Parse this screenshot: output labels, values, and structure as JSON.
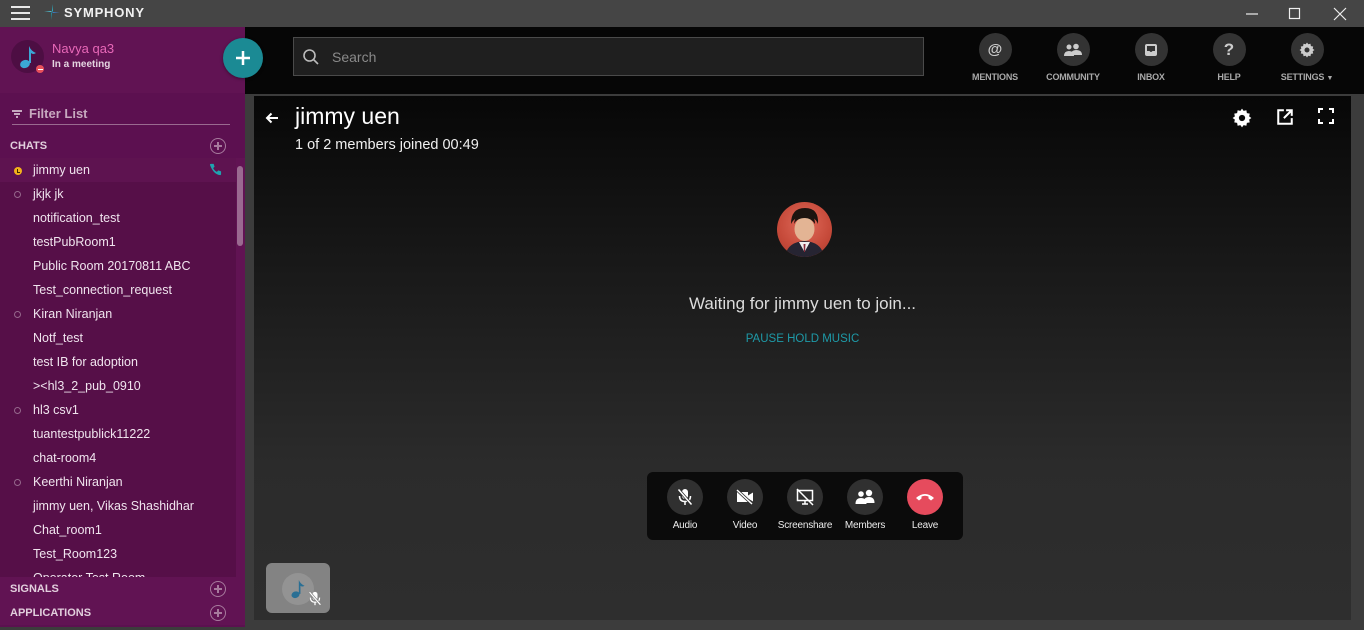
{
  "app": {
    "name": "SYMPHONY",
    "window_controls": {
      "minimize": "minimize",
      "maximize": "maximize",
      "close": "close"
    }
  },
  "profile": {
    "name": "Navya qa3",
    "status": "In a meeting"
  },
  "sidebar": {
    "filter_placeholder": "Filter List",
    "sections": {
      "chats": "CHATS",
      "signals": "SIGNALS",
      "applications": "APPLICATIONS"
    },
    "chats": [
      {
        "name": "jimmy uen",
        "presence": "away",
        "in_call": true,
        "active": true
      },
      {
        "name": "jkjk jk",
        "presence": "offline"
      },
      {
        "name": "notification_test",
        "presence": "none"
      },
      {
        "name": "testPubRoom1",
        "presence": "none"
      },
      {
        "name": "Public Room 20170811 ABC",
        "presence": "none"
      },
      {
        "name": "Test_connection_request",
        "presence": "none"
      },
      {
        "name": "Kiran Niranjan",
        "presence": "offline"
      },
      {
        "name": "Notf_test",
        "presence": "none"
      },
      {
        "name": "test IB for adoption",
        "presence": "none"
      },
      {
        "name": "><hl3_2_pub_0910",
        "presence": "none"
      },
      {
        "name": "hl3 csv1",
        "presence": "offline"
      },
      {
        "name": "tuantestpublick11222",
        "presence": "none"
      },
      {
        "name": "chat-room4",
        "presence": "none"
      },
      {
        "name": "Keerthi Niranjan",
        "presence": "offline"
      },
      {
        "name": "jimmy uen, Vikas Shashidhar",
        "presence": "none"
      },
      {
        "name": "Chat_room1",
        "presence": "none"
      },
      {
        "name": "Test_Room123",
        "presence": "none"
      },
      {
        "name": "Operator Test Room",
        "presence": "none"
      }
    ]
  },
  "topnav": {
    "search_placeholder": "Search",
    "buttons": {
      "mentions": "MENTIONS",
      "community": "COMMUNITY",
      "inbox": "INBOX",
      "help": "HELP",
      "settings": "SETTINGS"
    }
  },
  "call": {
    "title": "jimmy uen",
    "subtitle": "1 of 2 members joined 00:49",
    "waiting_text": "Waiting for jimmy uen to join...",
    "pause_music": "PAUSE HOLD MUSIC",
    "controls": {
      "audio": "Audio",
      "video": "Video",
      "screenshare": "Screenshare",
      "members": "Members",
      "leave": "Leave"
    }
  },
  "colors": {
    "sidebar": "#5c1050",
    "accent": "#1b8a94",
    "leave": "#e64b5d",
    "away": "#f3b21b",
    "profile_name": "#e868b8"
  }
}
